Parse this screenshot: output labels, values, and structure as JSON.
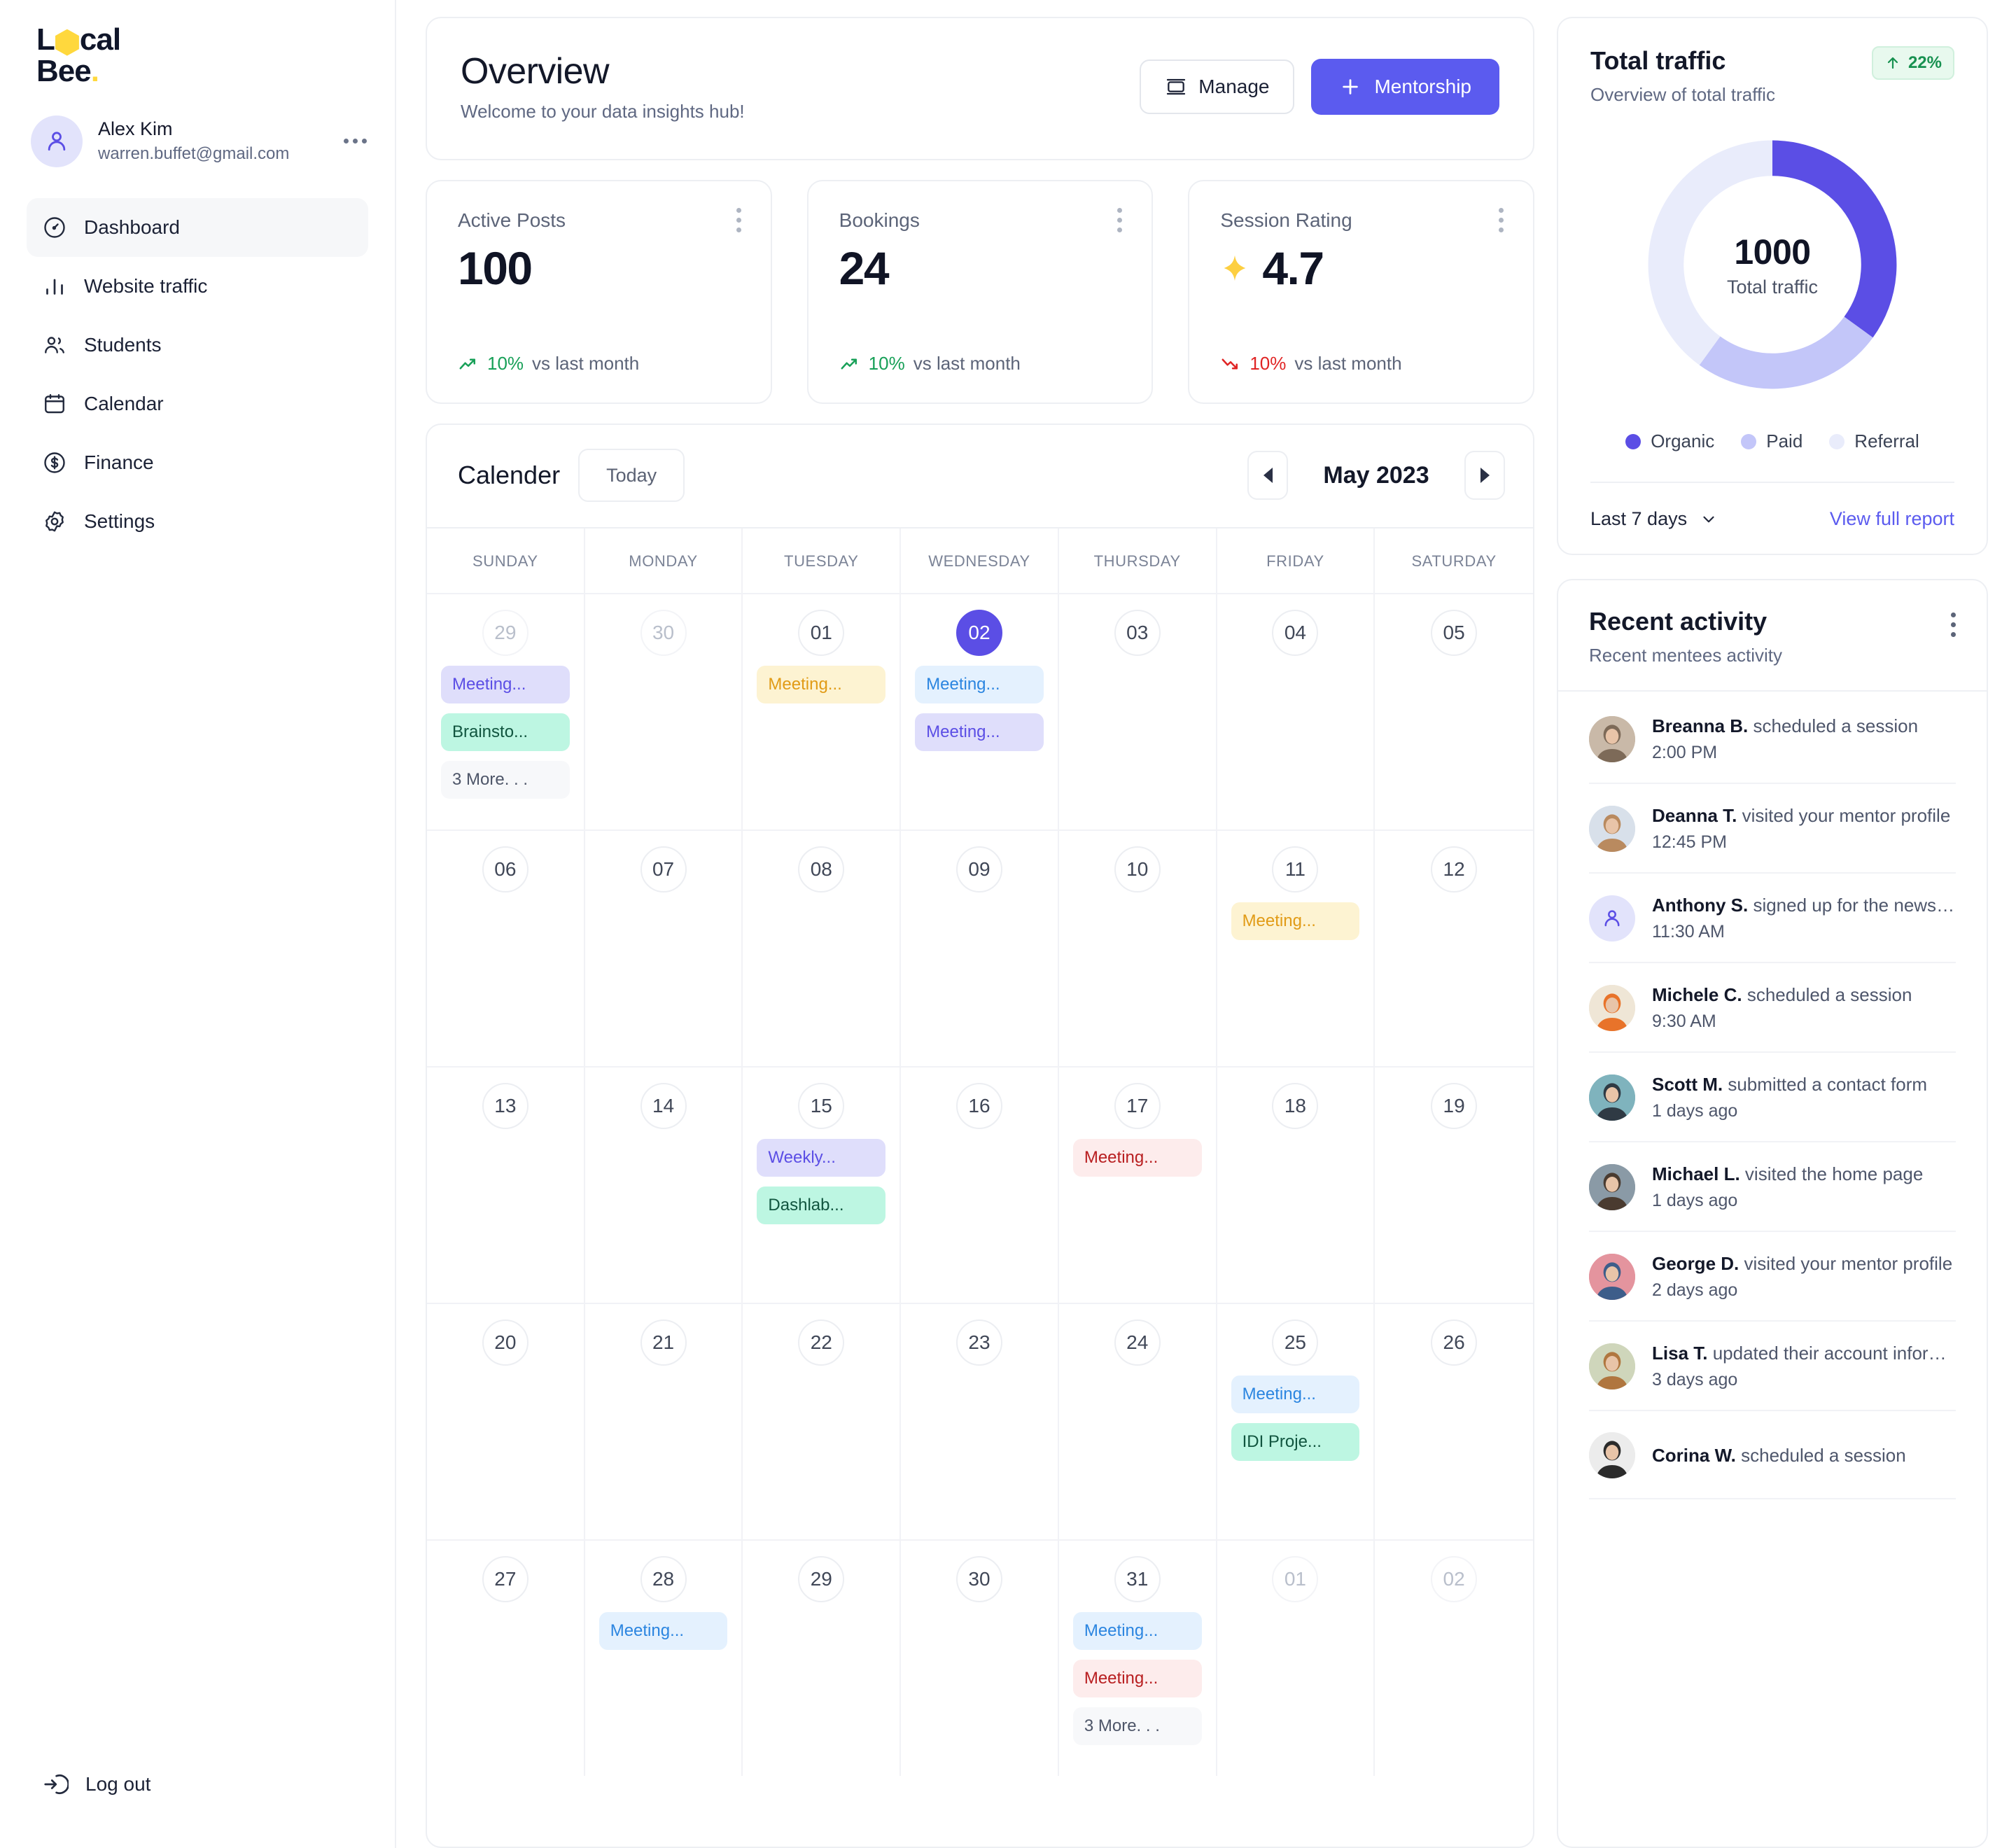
{
  "brand": {
    "line1_pre": "L",
    "line1_post": "cal",
    "line2": "Bee",
    "dot": "."
  },
  "profile": {
    "name": "Alex Kim",
    "email": "warren.buffet@gmail.com"
  },
  "sidebar": {
    "items": [
      {
        "label": "Dashboard",
        "icon": "gauge-icon",
        "active": true
      },
      {
        "label": "Website traffic",
        "icon": "bar-chart-icon",
        "active": false
      },
      {
        "label": "Students",
        "icon": "users-icon",
        "active": false
      },
      {
        "label": "Calendar",
        "icon": "calendar-icon",
        "active": false
      },
      {
        "label": "Finance",
        "icon": "dollar-circle-icon",
        "active": false
      },
      {
        "label": "Settings",
        "icon": "gear-icon",
        "active": false
      }
    ],
    "logout": "Log out"
  },
  "header": {
    "title": "Overview",
    "subtitle": "Welcome to your data insights hub!",
    "manage_label": "Manage",
    "mentorship_label": "Mentorship"
  },
  "stats": [
    {
      "label": "Active Posts",
      "value": "100",
      "star": false,
      "delta_pct": "10%",
      "delta_text": "vs last month",
      "direction": "up"
    },
    {
      "label": "Bookings",
      "value": "24",
      "star": false,
      "delta_pct": "10%",
      "delta_text": "vs last month",
      "direction": "up"
    },
    {
      "label": "Session Rating",
      "value": "4.7",
      "star": true,
      "delta_pct": "10%",
      "delta_text": "vs last month",
      "direction": "down"
    }
  ],
  "calendar": {
    "title": "Calender",
    "today_label": "Today",
    "month_label": "May 2023",
    "weekdays": [
      "SUNDAY",
      "MONDAY",
      "TUESDAY",
      "WEDNESDAY",
      "THURSDAY",
      "FRIDAY",
      "SATURDAY"
    ],
    "weeks": [
      [
        {
          "num": "29",
          "state": "muted",
          "events": [
            {
              "text": "Meeting...",
              "color": "purple"
            },
            {
              "text": "Brainsto...",
              "color": "green"
            },
            {
              "text": "3 More. . .",
              "color": "more"
            }
          ]
        },
        {
          "num": "30",
          "state": "muted",
          "events": []
        },
        {
          "num": "01",
          "state": "normal",
          "events": [
            {
              "text": "Meeting...",
              "color": "yellow"
            }
          ]
        },
        {
          "num": "02",
          "state": "today",
          "events": [
            {
              "text": "Meeting...",
              "color": "blue"
            },
            {
              "text": "Meeting...",
              "color": "purple"
            }
          ]
        },
        {
          "num": "03",
          "state": "normal",
          "events": []
        },
        {
          "num": "04",
          "state": "normal",
          "events": []
        },
        {
          "num": "05",
          "state": "normal",
          "events": []
        }
      ],
      [
        {
          "num": "06",
          "state": "normal",
          "events": []
        },
        {
          "num": "07",
          "state": "normal",
          "events": []
        },
        {
          "num": "08",
          "state": "normal",
          "events": []
        },
        {
          "num": "09",
          "state": "normal",
          "events": []
        },
        {
          "num": "10",
          "state": "normal",
          "events": []
        },
        {
          "num": "11",
          "state": "normal",
          "events": [
            {
              "text": "Meeting...",
              "color": "yellow"
            }
          ]
        },
        {
          "num": "12",
          "state": "normal",
          "events": []
        }
      ],
      [
        {
          "num": "13",
          "state": "normal",
          "events": []
        },
        {
          "num": "14",
          "state": "normal",
          "events": []
        },
        {
          "num": "15",
          "state": "normal",
          "events": [
            {
              "text": "Weekly...",
              "color": "purple"
            },
            {
              "text": "Dashlab...",
              "color": "green"
            }
          ]
        },
        {
          "num": "16",
          "state": "normal",
          "events": []
        },
        {
          "num": "17",
          "state": "normal",
          "events": [
            {
              "text": "Meeting...",
              "color": "red"
            }
          ]
        },
        {
          "num": "18",
          "state": "normal",
          "events": []
        },
        {
          "num": "19",
          "state": "normal",
          "events": []
        }
      ],
      [
        {
          "num": "20",
          "state": "normal",
          "events": []
        },
        {
          "num": "21",
          "state": "normal",
          "events": []
        },
        {
          "num": "22",
          "state": "normal",
          "events": []
        },
        {
          "num": "23",
          "state": "normal",
          "events": []
        },
        {
          "num": "24",
          "state": "normal",
          "events": []
        },
        {
          "num": "25",
          "state": "normal",
          "events": [
            {
              "text": "Meeting...",
              "color": "blue"
            },
            {
              "text": "IDI Proje...",
              "color": "green"
            }
          ]
        },
        {
          "num": "26",
          "state": "normal",
          "events": []
        }
      ],
      [
        {
          "num": "27",
          "state": "normal",
          "events": []
        },
        {
          "num": "28",
          "state": "normal",
          "events": [
            {
              "text": "Meeting...",
              "color": "blue"
            }
          ]
        },
        {
          "num": "29",
          "state": "normal",
          "events": []
        },
        {
          "num": "30",
          "state": "normal",
          "events": []
        },
        {
          "num": "31",
          "state": "normal",
          "events": [
            {
              "text": "Meeting...",
              "color": "blue"
            },
            {
              "text": "Meeting...",
              "color": "red"
            },
            {
              "text": "3 More. . .",
              "color": "more"
            }
          ]
        },
        {
          "num": "01",
          "state": "muted",
          "events": []
        },
        {
          "num": "02",
          "state": "muted",
          "events": []
        }
      ]
    ]
  },
  "traffic": {
    "title": "Total traffic",
    "subtitle": "Overview of total traffic",
    "badge_value": "22%",
    "center_value": "1000",
    "center_caption": "Total traffic",
    "range_label": "Last 7 days",
    "report_link": "View full report"
  },
  "chart_data": {
    "type": "pie",
    "title": "Total traffic",
    "subtitle": "Overview of total traffic",
    "center_label": "1000",
    "center_sublabel": "Total traffic",
    "total": 1000,
    "categories": [
      "Organic",
      "Paid",
      "Referral"
    ],
    "values": [
      350,
      250,
      400
    ],
    "percents": [
      35,
      25,
      40
    ],
    "colors": [
      "#5b4ee5",
      "#c3c6f9",
      "#e9ecfb"
    ],
    "legend_position": "bottom",
    "grid": false,
    "change_badge": "22%",
    "change_direction": "up"
  },
  "recent": {
    "title": "Recent activity",
    "subtitle": "Recent mentees activity",
    "items": [
      {
        "name": "Breanna B.",
        "action": "scheduled a session",
        "time": "2:00 PM",
        "avatar": "photo",
        "av1": "#c9b9a8",
        "av2": "#7d6a58"
      },
      {
        "name": "Deanna T.",
        "action": "visited your mentor profile",
        "time": "12:45 PM",
        "avatar": "photo",
        "av1": "#d8e0ea",
        "av2": "#b98a5f"
      },
      {
        "name": "Anthony S.",
        "action": "signed up for the newsle...",
        "time": "11:30 AM",
        "avatar": "placeholder",
        "av1": "#e2e3fb",
        "av2": "#e2e3fb"
      },
      {
        "name": "Michele C.",
        "action": "scheduled a session",
        "time": "9:30 AM",
        "avatar": "photo",
        "av1": "#efe6d6",
        "av2": "#e8732a"
      },
      {
        "name": "Scott M.",
        "action": "submitted a contact form",
        "time": "1 days ago",
        "avatar": "photo",
        "av1": "#7fb3bd",
        "av2": "#2f3a44"
      },
      {
        "name": "Michael L.",
        "action": "visited the home page",
        "time": "1 days ago",
        "avatar": "photo",
        "av1": "#8a9aa6",
        "av2": "#4a3b30"
      },
      {
        "name": "George D.",
        "action": "visited your mentor profile",
        "time": "2 days ago",
        "avatar": "photo",
        "av1": "#e4949e",
        "av2": "#3d5d8a"
      },
      {
        "name": "Lisa T.",
        "action": "updated their account inform...",
        "time": "3 days ago",
        "avatar": "photo",
        "av1": "#cfd6bb",
        "av2": "#b0763f"
      },
      {
        "name": "Corina W.",
        "action": "scheduled a session",
        "time": "",
        "avatar": "photo",
        "av1": "#ececec",
        "av2": "#2b2b2b"
      }
    ]
  }
}
